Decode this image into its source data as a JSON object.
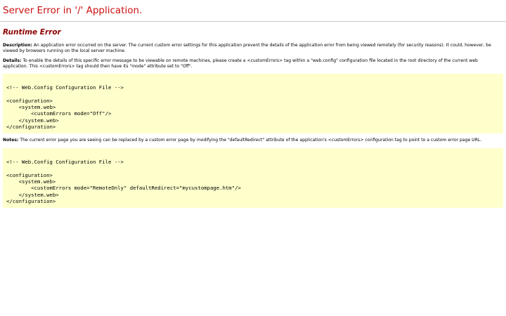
{
  "page": {
    "title": "Server Error in '/' Application.",
    "subtitle": "Runtime Error"
  },
  "description": {
    "label": "Description:",
    "text": " An application error occurred on the server. The current custom error settings for this application prevent the details of the application error from being viewed remotely (for security reasons). It could, however, be viewed by browsers running on the local server machine."
  },
  "details": {
    "label": "Details:",
    "text": " To enable the details of this specific error message to be viewable on remote machines, please create a <customErrors> tag within a \"web.config\" configuration file located in the root directory of the current web application. This <customErrors> tag should then have its \"mode\" attribute set to \"Off\"."
  },
  "code_block_1": {
    "lines": [
      "",
      "<!-- Web.Config Configuration File -->",
      "",
      "<configuration>",
      "    <system.web>",
      "        <customErrors mode=\"Off\"/>",
      "    </system.web>",
      "</configuration>"
    ]
  },
  "notes": {
    "label": "Notes:",
    "text": " The current error page you are seeing can be replaced by a custom error page by modifying the \"defaultRedirect\" attribute of the application's <customErrors> configuration tag to point to a custom error page URL."
  },
  "code_block_2": {
    "lines": [
      "",
      "<!-- Web.Config Configuration File -->",
      "",
      "<configuration>",
      "    <system.web>",
      "        <customErrors mode=\"RemoteOnly\" defaultRedirect=\"mycustompage.htm\"/>",
      "    </system.web>",
      "</configuration>"
    ]
  }
}
